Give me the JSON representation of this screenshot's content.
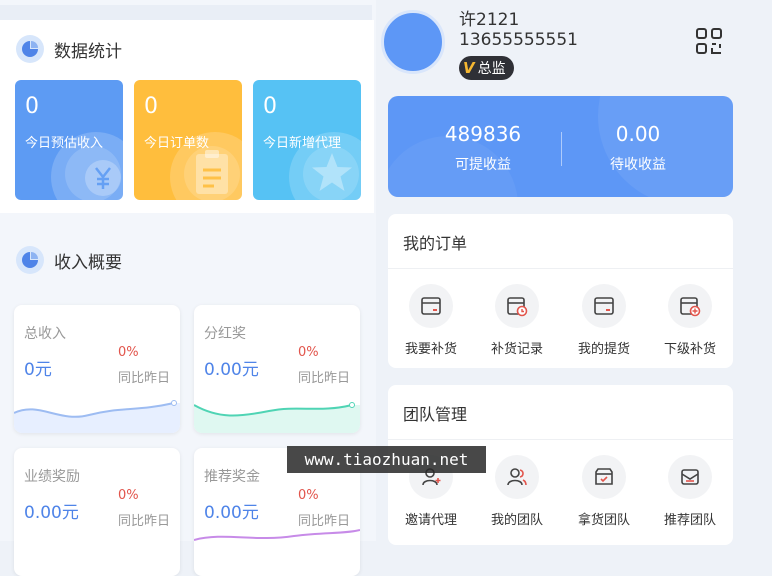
{
  "stats_section": {
    "title": "数据统计",
    "cards": [
      {
        "value": "0",
        "label": "今日预估收入",
        "color": "#5d9bf3",
        "icon": "yuan-icon"
      },
      {
        "value": "0",
        "label": "今日订单数",
        "color": "#ffbe3d",
        "icon": "clipboard-icon"
      },
      {
        "value": "0",
        "label": "今日新增代理",
        "color": "#56c2f4",
        "icon": "star-icon"
      }
    ]
  },
  "income_section": {
    "title": "收入概要",
    "cards": [
      {
        "title": "总收入",
        "value": "0元",
        "percent": "0%",
        "compare": "同比昨日",
        "wave_color": "#9dbcf2"
      },
      {
        "title": "分红奖",
        "value": "0.00元",
        "percent": "0%",
        "compare": "同比昨日",
        "wave_color": "#4fd4b4"
      },
      {
        "title": "业绩奖励",
        "value": "0.00元",
        "percent": "0%",
        "compare": "同比昨日",
        "wave_color": "#9dbcf2"
      },
      {
        "title": "推荐奖金",
        "value": "0.00元",
        "percent": "0%",
        "compare": "同比昨日",
        "wave_color": "#c78be8"
      }
    ]
  },
  "profile": {
    "name": "许2121",
    "phone": "13655555551",
    "badge_letter": "V",
    "badge_label": "总监",
    "qr_icon": "qr-scan-icon"
  },
  "earnings": {
    "withdrawable_value": "489836",
    "withdrawable_label": "可提收益",
    "pending_value": "0.00",
    "pending_label": "待收收益"
  },
  "orders": {
    "title": "我的订单",
    "items": [
      {
        "label": "我要补货",
        "icon": "replenish-icon"
      },
      {
        "label": "补货记录",
        "icon": "replenish-record-icon"
      },
      {
        "label": "我的提货",
        "icon": "pickup-icon"
      },
      {
        "label": "下级补货",
        "icon": "sub-replenish-icon"
      }
    ]
  },
  "team": {
    "title": "团队管理",
    "items": [
      {
        "label": "邀请代理",
        "icon": "invite-agent-icon"
      },
      {
        "label": "我的团队",
        "icon": "my-team-icon"
      },
      {
        "label": "拿货团队",
        "icon": "purchase-team-icon"
      },
      {
        "label": "推荐团队",
        "icon": "referral-team-icon"
      }
    ]
  },
  "watermark": "www.tiaozhuan.net"
}
